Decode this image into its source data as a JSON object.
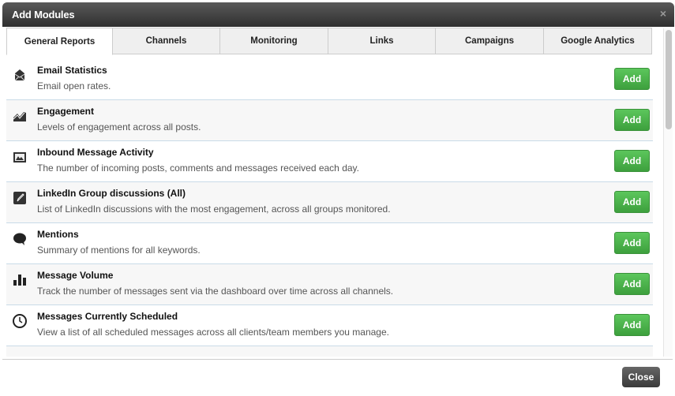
{
  "dialog": {
    "title": "Add Modules",
    "close_icon": "×",
    "close_label": "Close"
  },
  "tabs": [
    {
      "label": "General Reports",
      "active": true
    },
    {
      "label": "Channels"
    },
    {
      "label": "Monitoring"
    },
    {
      "label": "Links"
    },
    {
      "label": "Campaigns"
    },
    {
      "label": "Google Analytics"
    }
  ],
  "modules": [
    {
      "title": "Email Statistics",
      "desc": "Email open rates.",
      "icon": "envelope-icon",
      "add": "Add"
    },
    {
      "title": "Engagement",
      "desc": "Levels of engagement across all posts.",
      "icon": "line-chart-icon",
      "add": "Add"
    },
    {
      "title": "Inbound Message Activity",
      "desc": "The number of incoming posts, comments and messages received each day.",
      "icon": "image-icon",
      "add": "Add"
    },
    {
      "title": "LinkedIn Group discussions (All)",
      "desc": "List of LinkedIn discussions with the most engagement, across all groups monitored.",
      "icon": "edit-icon",
      "add": "Add"
    },
    {
      "title": "Mentions",
      "desc": "Summary of mentions for all keywords.",
      "icon": "speech-bubble-icon",
      "add": "Add"
    },
    {
      "title": "Message Volume",
      "desc": "Track the number of messages sent via the dashboard over time across all channels.",
      "icon": "bar-chart-icon",
      "add": "Add"
    },
    {
      "title": "Messages Currently Scheduled",
      "desc": "View a list of all scheduled messages across all clients/team members you manage.",
      "icon": "clock-icon",
      "add": "Add"
    }
  ],
  "colors": {
    "add_button": "#4cb64c",
    "header": "#3a3a3a",
    "close_button": "#4a4a4a"
  }
}
